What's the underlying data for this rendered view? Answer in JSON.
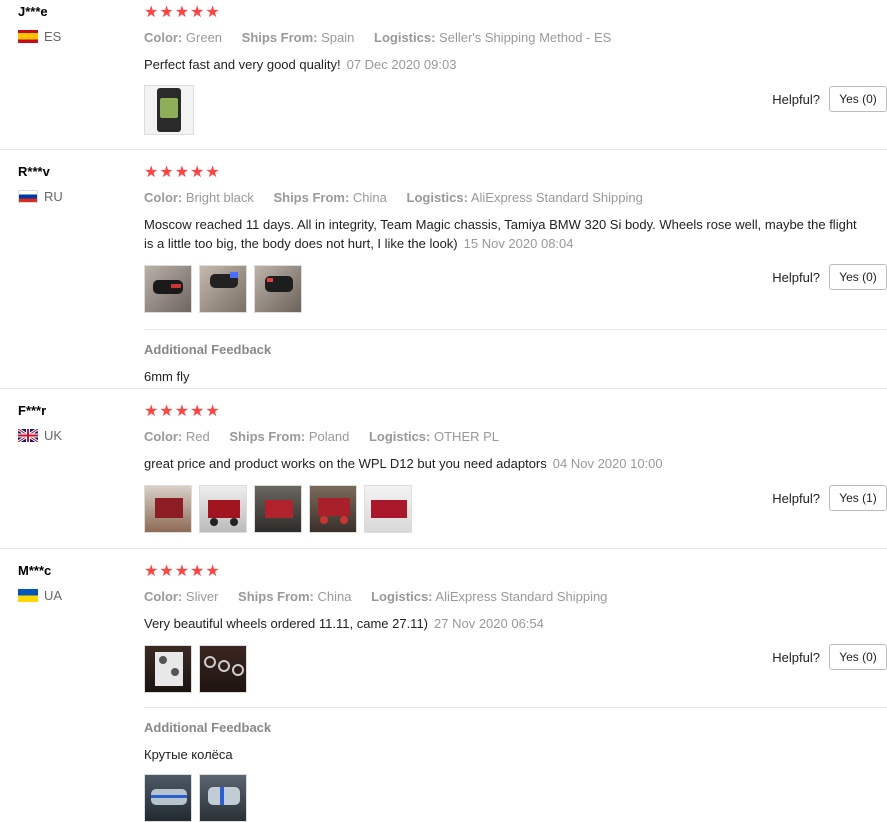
{
  "reviews": [
    {
      "user": "J***e",
      "country": "ES",
      "stars": "★★★★★",
      "color_label": "Color:",
      "color": "Green",
      "ships_label": "Ships From:",
      "ships_from": "Spain",
      "logistics_label": "Logistics:",
      "logistics": "Seller's Shipping Method - ES",
      "text": "Perfect fast and very good quality!",
      "date": "07 Dec 2020 09:03",
      "helpful_label": "Helpful?",
      "yes": "Yes (0)"
    },
    {
      "user": "R***v",
      "country": "RU",
      "stars": "★★★★★",
      "color_label": "Color:",
      "color": "Bright black",
      "ships_label": "Ships From:",
      "ships_from": "China",
      "logistics_label": "Logistics:",
      "logistics": "AliExpress Standard Shipping",
      "text": "Moscow reached 11 days. All in integrity, Team Magic chassis, Tamiya BMW 320 Si body. Wheels rose well, maybe the flight is a little too big, the body does not hurt, I like the look)",
      "date": "15 Nov 2020 08:04",
      "helpful_label": "Helpful?",
      "yes": "Yes (0)",
      "additional_title": "Additional Feedback",
      "additional_text": "6mm fly"
    },
    {
      "user": "F***r",
      "country": "UK",
      "stars": "★★★★★",
      "color_label": "Color:",
      "color": "Red",
      "ships_label": "Ships From:",
      "ships_from": "Poland",
      "logistics_label": "Logistics:",
      "logistics": "OTHER PL",
      "text": "great price and product works on the WPL D12 but you need adaptors",
      "date": "04 Nov 2020 10:00",
      "helpful_label": "Helpful?",
      "yes": "Yes (1)"
    },
    {
      "user": "M***c",
      "country": "UA",
      "stars": "★★★★★",
      "color_label": "Color:",
      "color": "Sliver",
      "ships_label": "Ships From:",
      "ships_from": "China",
      "logistics_label": "Logistics:",
      "logistics": "AliExpress Standard Shipping",
      "text": "Very beautiful wheels ordered 11.11, came 27.11)",
      "date": "27 Nov 2020 06:54",
      "helpful_label": "Helpful?",
      "yes": "Yes (0)",
      "additional_title": "Additional Feedback",
      "additional_text": "Крутые колёса"
    }
  ],
  "colors": {
    "star": "#ff4747",
    "muted": "#999999",
    "divider": "#e8e8e8"
  }
}
